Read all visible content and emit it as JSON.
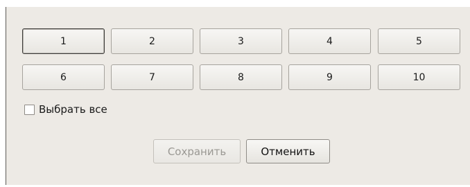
{
  "number_buttons": [
    "1",
    "2",
    "3",
    "4",
    "5",
    "6",
    "7",
    "8",
    "9",
    "10"
  ],
  "focused_button": "1",
  "select_all": {
    "label": "Выбрать все",
    "checked": false
  },
  "actions": {
    "save_label": "Сохранить",
    "save_enabled": false,
    "cancel_label": "Отменить"
  }
}
